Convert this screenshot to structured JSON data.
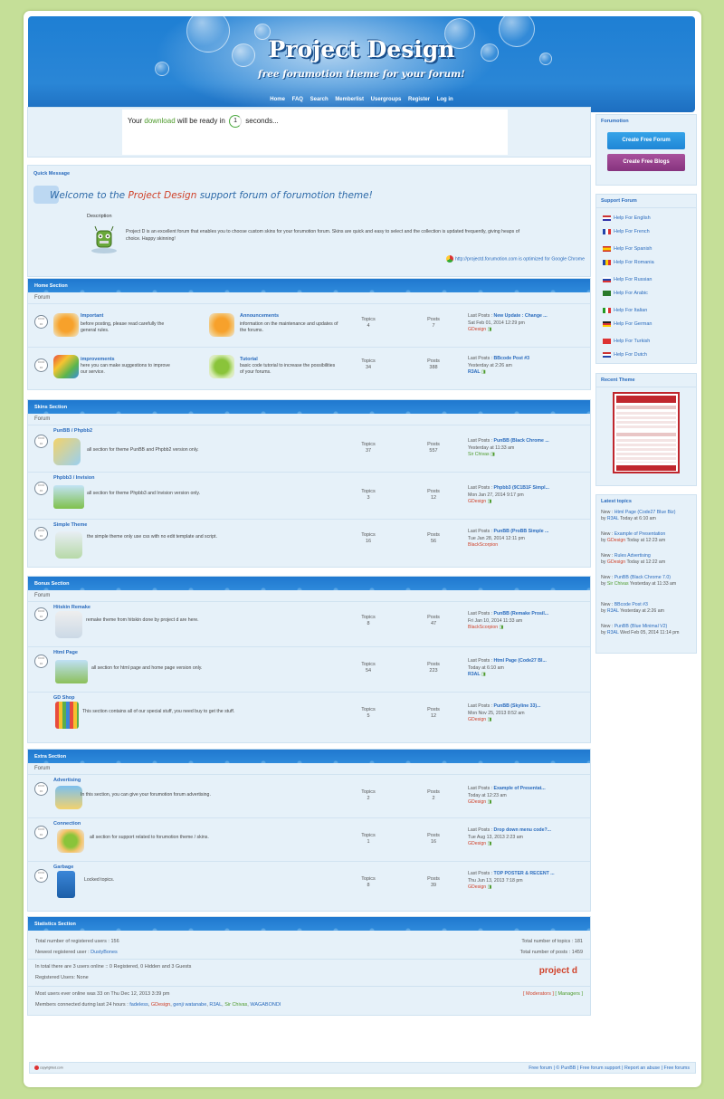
{
  "banner": {
    "title": "Project Design",
    "subtitle": "free forumotion theme for your forum!",
    "nav": [
      "Home",
      "FAQ",
      "Search",
      "Memberlist",
      "Usergroups",
      "Register",
      "Log in"
    ]
  },
  "ad": {
    "prefix": "Your",
    "link": "download",
    "middle": "will be ready in",
    "count": "1",
    "suffix": "seconds..."
  },
  "quick": {
    "title": "Quick Message",
    "welcome_a": "Welcome to the ",
    "welcome_b": "Project Design",
    "welcome_c": " support forum of forumotion theme!",
    "desc_label": "Description",
    "desc": "Project D is an excellent forum that enables you to choose custom skins for your forumotion forum. Skins are quick and easy to select and the collection is updated frequently, giving heaps of choice. Happy skinning!",
    "chrome": "http://projectd.forumotion.com is optimized for Google Chrome"
  },
  "labels": {
    "forum": "Forum",
    "topics": "Topics",
    "posts": "Posts"
  },
  "home": {
    "title": "Home Section",
    "f1": {
      "name": "Important",
      "desc": "before posting, please read carefully the general rules.",
      "topics": "4",
      "posts": "7"
    },
    "f2": {
      "name": "Announcements",
      "desc": "information on the maintenance and updates of the forums."
    },
    "last1": {
      "label": "Last Posts : ",
      "title": "New Update : Change ...",
      "date": "Sat Feb 01, 2014 12:29 pm",
      "user": "GDesign"
    },
    "f3": {
      "name": "improvements",
      "desc": "here you can make suggestions to improve our service.",
      "topics": "34",
      "posts": "388"
    },
    "f4": {
      "name": "Tutorial",
      "desc": "basic code tutorial to increase the possibilities of your forums."
    },
    "last2": {
      "label": "Last Posts : ",
      "title": "BBcode Post #3",
      "date": "Yesterday at 2:26 am",
      "user": "R3AL"
    }
  },
  "skins": {
    "title": "Skins Section",
    "r1": {
      "name": "PunBB / Phpbb2",
      "desc": "all section for theme PunBB and Phpbb2 version only.",
      "topics": "37",
      "posts": "557",
      "label": "Last Posts : ",
      "last": "PunBB (Black Chrome ...",
      "date": "Yesterday at 11:33 am",
      "user": "Sir Chivas"
    },
    "r2": {
      "name": "Phpbb3 / Invision",
      "desc": "all section for theme Phpbb3 and Invision version only.",
      "topics": "3",
      "posts": "12",
      "label": "Last Posts : ",
      "last": "Phpbb3 (9C1B1F Simpl...",
      "date": "Mon Jan 27, 2014 9:17 pm",
      "user": "GDesign"
    },
    "r3": {
      "name": "Simple Theme",
      "desc": "the simple theme only use css with no edit template and script.",
      "topics": "16",
      "posts": "56",
      "label": "Last Posts : ",
      "last": "PunBB (ProBB Simple ...",
      "date": "Tue Jan 28, 2014 12:11 pm",
      "user": "BlackScorpion"
    }
  },
  "bonus": {
    "title": "Bonus Section",
    "r1": {
      "name": "Hitskin Remake",
      "desc": "remake theme from hitskin done by project d are here.",
      "topics": "8",
      "posts": "47",
      "label": "Last Posts : ",
      "last": "PunBB (Remake Prosil...",
      "date": "Fri Jan 10, 2014 11:33 am",
      "user": "BlackScorpion"
    },
    "r2": {
      "name": "Html Page",
      "desc": "all section for html page and home page version only.",
      "topics": "54",
      "posts": "223",
      "label": "Last Posts : ",
      "last": "Html Page (Code27 Bl...",
      "date": "Today at 6:10 am",
      "user": "R3AL"
    },
    "r3": {
      "name": "GD Shop",
      "desc": "This section contains all of our special stuff, you need buy to get the stuff.",
      "topics": "5",
      "posts": "12",
      "label": "Last Posts : ",
      "last": "PunBB (Skyline 33)...",
      "date": "Mon Nov 25, 2013 8:52 am",
      "user": "GDesign"
    }
  },
  "extra": {
    "title": "Extra Section",
    "r1": {
      "name": "Advertising",
      "desc": "In this section, you can give your forumotion forum advertising.",
      "topics": "2",
      "posts": "2",
      "label": "Last Posts : ",
      "last": "Example of Presentat...",
      "date": "Today at 12:23 am",
      "user": "GDesign"
    },
    "r2": {
      "name": "Connection",
      "desc": "all section for support related to forumotion theme / skins.",
      "topics": "1",
      "posts": "16",
      "label": "Last Posts : ",
      "last": "Drop down menu code?...",
      "date": "Tue Aug 13, 2013 2:23 am",
      "user": "GDesign"
    },
    "r3": {
      "name": "Garbage",
      "desc": "Locked topics.",
      "topics": "8",
      "posts": "39",
      "label": "Last Posts : ",
      "last": "TOP POSTER & RECENT ...",
      "date": "Thu Jun 13, 2013 7:18 pm",
      "user": "GDesign"
    }
  },
  "stats": {
    "title": "Statistics Section",
    "total_users": "Total number of registered users : 156",
    "newest_label": "Newest registered user : ",
    "newest": "DustyBones",
    "total_topics": "Total number of topics : 181",
    "total_posts": "Total number of posts : 1459",
    "online": "In total there are 3 users online :: 0 Registered, 0 Hidden and 3 Guests",
    "registered": "Registered Users: None",
    "logo": "project d",
    "most": "Most users ever online was 33 on Thu Dec 12, 2013 3:39 pm",
    "connected_label": "Members connected during last 24 hours : ",
    "u1": "fadeless",
    "u2": "GDesign",
    "u3": "genji watanabe",
    "u4": "R3AL",
    "u5": "Sir Chivas",
    "u6": "WAGABONDI",
    "moderators": "[ Moderators ]",
    "managers": "[ Managers ]"
  },
  "sidebar": {
    "forumotion": "Forumotion",
    "create_forum": "Create Free Forum",
    "create_blogs": "Create Free Blogs",
    "support": "Support Forum",
    "helps": [
      "Help For English",
      "Help For French",
      "Help For Spanish",
      "Help For Romania",
      "Help For Russian",
      "Help For Arabic",
      "Help For Italian",
      "Help For German",
      "Help For Turkish",
      "Help For Dutch"
    ],
    "recent": "Recent Theme",
    "latest": "Latest topics",
    "topics": [
      {
        "a": "New : ",
        "t": "Html Page (Code27 Blue Biz)",
        "u": "R3AL",
        "d": " Today at 6:10 am"
      },
      {
        "a": "New : ",
        "t": "Example of Presentation",
        "u": "GDesign",
        "d": " Today at 12:23 am"
      },
      {
        "a": "New : ",
        "t": "Rules Advertising",
        "u": "GDesign",
        "d": " Today at 12:22 am"
      },
      {
        "a": "New : ",
        "t": "PunBB (Black Chrome 7.0)",
        "u": "Sir Chivas",
        "d": " Yesterday at 11:33 am"
      },
      {
        "a": "New : ",
        "t": "BBcode Post #3",
        "u": "R3AL",
        "d": " Yesterday at 2:26 am"
      },
      {
        "a": "New : ",
        "t": "PunBB (Blue Minimal V2)",
        "u": "R3AL",
        "d": " Wed Feb 05, 2014 11:14 pm"
      }
    ]
  },
  "footer": {
    "links": "Free forum | © PunBB | Free forum support | Report an abuse | Free forums",
    "copy": "copyrighted.com"
  },
  "colors": {
    "accent": "#2a6bbd",
    "header": "#1f78cf",
    "page_bg": "#c5df98",
    "user_red": "#d0422a",
    "user_green": "#4c9a2a"
  }
}
